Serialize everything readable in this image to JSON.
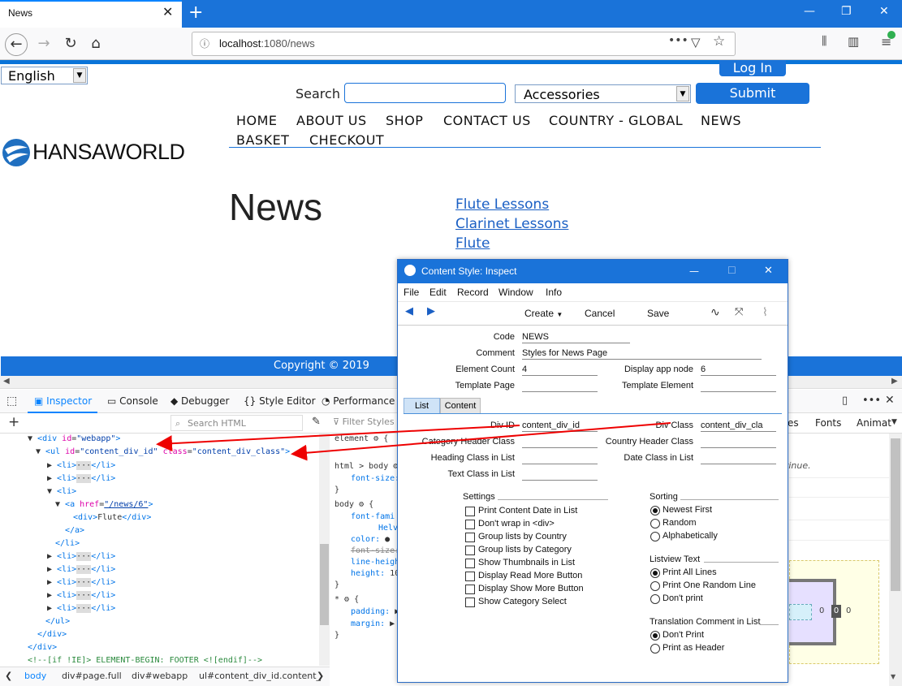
{
  "browser": {
    "tab_title": "News",
    "url_host": "localhost",
    "url_path": ":1080/news"
  },
  "site": {
    "language": "English",
    "login_label": "Log In",
    "search_label": "Search",
    "category": "Accessories",
    "submit_label": "Submit",
    "menu": [
      "HOME",
      "ABOUT US",
      "SHOP",
      "CONTACT US",
      "COUNTRY - GLOBAL",
      "NEWS",
      "BASKET",
      "CHECKOUT"
    ],
    "logo_text": "HANSAWORLD",
    "page_title": "News",
    "news_links": [
      "Flute Lessons",
      "Clarinet Lessons",
      "Flute"
    ],
    "footer": "Copyright © 2019"
  },
  "devtools": {
    "tabs": [
      "Inspector",
      "Console",
      "Debugger",
      "Style Editor",
      "Performance"
    ],
    "search_placeholder": "Search HTML",
    "filter_placeholder": "Filter Styles",
    "right_tabs": [
      "es",
      "Fonts",
      "Animat"
    ],
    "breadcrumb": [
      "body",
      "div#page.full",
      "div#webapp",
      "ul#content_div_id.content_"
    ],
    "hint_text": "tinue.",
    "box_values": [
      "0",
      "0",
      "0"
    ]
  },
  "dialog": {
    "title": "Content Style: Inspect",
    "menu": [
      "File",
      "Edit",
      "Record",
      "Window",
      "Info"
    ],
    "toolbar": {
      "create": "Create",
      "cancel": "Cancel",
      "save": "Save"
    },
    "fields": {
      "code_label": "Code",
      "code": "NEWS",
      "comment_label": "Comment",
      "comment": "Styles for News Page",
      "element_count_label": "Element Count",
      "element_count": "4",
      "display_app_node_label": "Display app node",
      "display_app_node": "6",
      "template_page_label": "Template Page",
      "template_page": "",
      "template_element_label": "Template Element",
      "template_element": ""
    },
    "tabs": [
      "List",
      "Content"
    ],
    "list": {
      "div_id_label": "Div ID",
      "div_id": "content_div_id",
      "div_class_label": "Div Class",
      "div_class": "content_div_cla",
      "category_header_label": "Category Header Class",
      "country_header_label": "Country Header Class",
      "heading_class_label": "Heading Class in List",
      "date_class_label": "Date Class in List",
      "text_class_label": "Text Class in List"
    },
    "settings_title": "Settings",
    "settings": [
      "Print Content Date in List",
      "Don't wrap in <div>",
      "Group lists by Country",
      "Group lists by Category",
      "Show Thumbnails in List",
      "Display Read More Button",
      "Display Show More Button",
      "Show Category Select"
    ],
    "sorting_title": "Sorting",
    "sorting": [
      "Newest First",
      "Random",
      "Alphabetically"
    ],
    "sorting_selected": 0,
    "listview_title": "Listview Text",
    "listview": [
      "Print All Lines",
      "Print One Random Line",
      "Don't print"
    ],
    "listview_selected": 0,
    "translation_title": "Translation Comment in List",
    "translation": [
      "Don't Print",
      "Print as Header"
    ],
    "translation_selected": 0
  },
  "code_lines": [
    {
      "indent": 3,
      "html": "<span class='tagc'>&lt;div</span> <span class='attrn'>id</span>=<span class='attrv'>\"webapp\"</span><span class='tagc'>&gt;</span>"
    }
  ]
}
